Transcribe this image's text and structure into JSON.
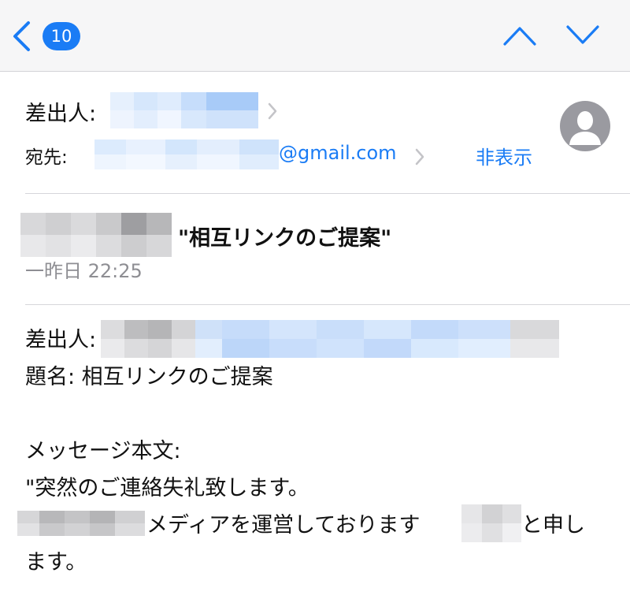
{
  "nav": {
    "unread_count": "10",
    "icons": {
      "back": "chevron-left-icon",
      "prev": "chevron-up-icon",
      "next": "chevron-down-icon"
    },
    "accent_color": "#1a7cf5"
  },
  "header": {
    "from_label": "差出人:",
    "to_label": "宛先:",
    "to_email": "@gmail.com",
    "hide_label": "非表示",
    "avatar_icon": "person-silhouette-icon"
  },
  "message": {
    "subject": "\"相互リンクのご提案\"",
    "date": "一昨日 22:25"
  },
  "body": {
    "from_label": "差出人:",
    "subject_line": "題名: 相互リンクのご提案",
    "message_label": "メッセージ本文:",
    "line1": "\"突然のご連絡失礼致します。",
    "line2_mid": "メディアを運営しております",
    "line2_end": "と申し",
    "line3": "ます。"
  }
}
